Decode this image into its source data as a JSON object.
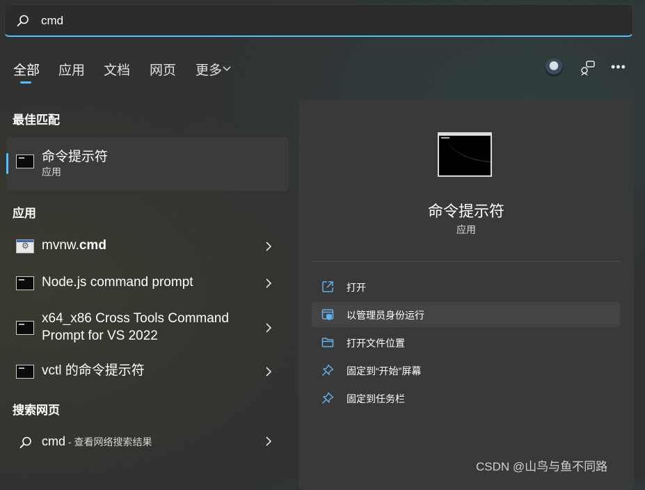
{
  "search": {
    "value": "cmd",
    "icon": "search-icon"
  },
  "tabs": [
    {
      "label": "全部",
      "active": true
    },
    {
      "label": "应用"
    },
    {
      "label": "文档"
    },
    {
      "label": "网页"
    },
    {
      "label": "更多"
    }
  ],
  "sections": {
    "best_match": "最佳匹配",
    "apps": "应用",
    "web": "搜索网页"
  },
  "best_match": {
    "title": "命令提示符",
    "subtitle": "应用"
  },
  "apps": [
    {
      "name_plain": "mvnw.",
      "name_bold": "cmd",
      "icon": "settings-file-icon"
    },
    {
      "name": "Node.js command prompt",
      "icon": "cmd-icon"
    },
    {
      "name_line1": "x64_x86 Cross Tools Command",
      "name_line2": "Prompt for VS 2022",
      "icon": "cmd-icon"
    },
    {
      "name": "vctl 的命令提示符",
      "icon": "cmd-icon"
    }
  ],
  "web_search": {
    "query": "cmd",
    "desc": " - 查看网络搜索结果"
  },
  "detail": {
    "title": "命令提示符",
    "subtitle": "应用",
    "actions": [
      {
        "label": "打开",
        "icon": "open-icon"
      },
      {
        "label": "以管理员身份运行",
        "icon": "admin-shield-icon",
        "highlighted": true
      },
      {
        "label": "打开文件位置",
        "icon": "folder-icon"
      },
      {
        "label": "固定到“开始”屏幕",
        "icon": "pin-icon"
      },
      {
        "label": "固定到任务栏",
        "icon": "pin-icon"
      }
    ]
  },
  "watermark": "CSDN @山鸟与鱼不同路",
  "colors": {
    "accent": "#4cc2ff",
    "icon_blue": "#5fb4f0",
    "background": "#313131"
  }
}
